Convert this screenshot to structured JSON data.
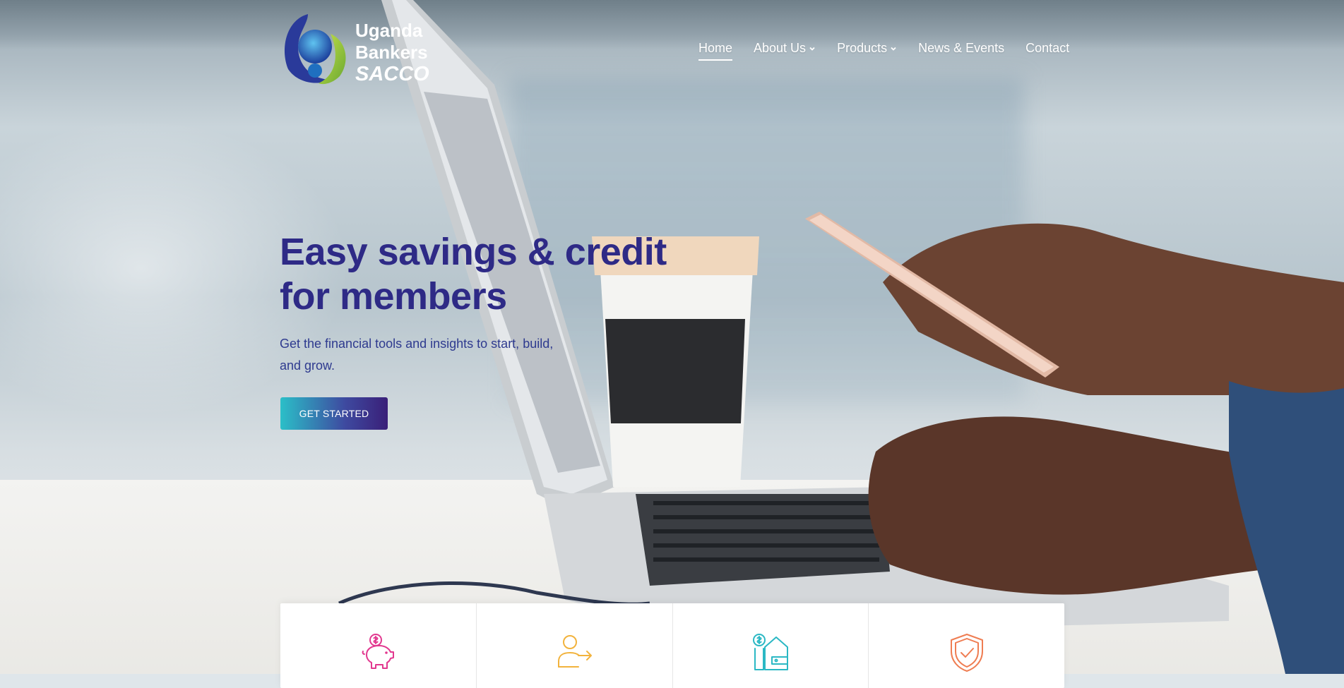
{
  "brand": {
    "line1": "Uganda",
    "line2": "Bankers",
    "line3": "SACCO"
  },
  "nav": {
    "items": [
      {
        "label": "Home",
        "active": true,
        "dropdown": false
      },
      {
        "label": "About Us",
        "active": false,
        "dropdown": true
      },
      {
        "label": "Products",
        "active": false,
        "dropdown": true
      },
      {
        "label": "News & Events",
        "active": false,
        "dropdown": false
      },
      {
        "label": "Contact",
        "active": false,
        "dropdown": false
      }
    ]
  },
  "hero": {
    "headline_line1": "Easy savings & credit",
    "headline_line2": "for members",
    "subtext_line1": "Get the financial tools and insights to start, build,",
    "subtext_line2": "and grow.",
    "cta_label": "GET STARTED"
  },
  "features": [
    {
      "icon": "piggy-bank-icon",
      "color": "#e2388f"
    },
    {
      "icon": "user-transfer-icon",
      "color": "#f2b33d"
    },
    {
      "icon": "wallet-house-icon",
      "color": "#2bb8c4"
    },
    {
      "icon": "shield-check-icon",
      "color": "#ef7d52"
    }
  ],
  "colors": {
    "headline": "#2e2a86",
    "cta_start": "#2bbfc8",
    "cta_end": "#3a1f78"
  }
}
